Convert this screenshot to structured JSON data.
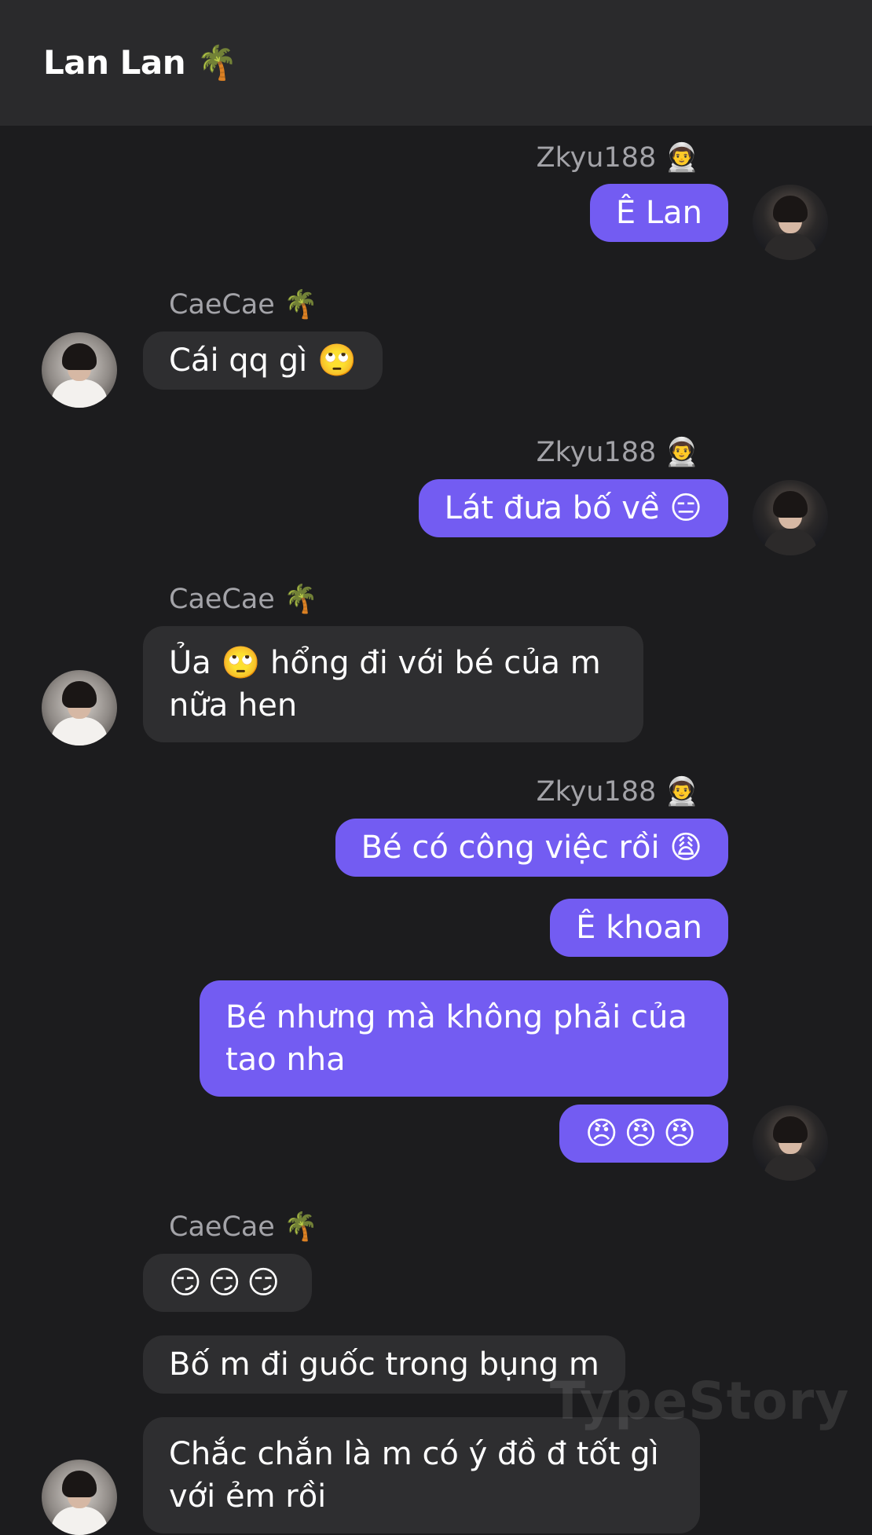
{
  "header": {
    "title": "Lan Lan 🌴"
  },
  "senders": {
    "me": "Zkyu188 👨‍🚀",
    "them": "CaeCae 🌴"
  },
  "messages": [
    {
      "text": "Ê Lan"
    },
    {
      "text": "Cái qq gì 🙄"
    },
    {
      "text": "Lát đưa bố về 😑"
    },
    {
      "text": "Ủa 🙄 hổng đi với bé của m\nnữa hen"
    },
    {
      "text": "Bé có công việc rồi 😩"
    },
    {
      "text": "Ê khoan"
    },
    {
      "text": "Bé nhưng mà không phải của\ntao nha"
    },
    {
      "text": "😠😠😠"
    },
    {
      "text": "😏😏😏"
    },
    {
      "text": "Bố m đi guốc trong bụng m"
    },
    {
      "text": "Chắc chắn là m có ý đồ đ tốt gì\nvới ẻm rồi"
    }
  ],
  "watermark": "TypeStory"
}
